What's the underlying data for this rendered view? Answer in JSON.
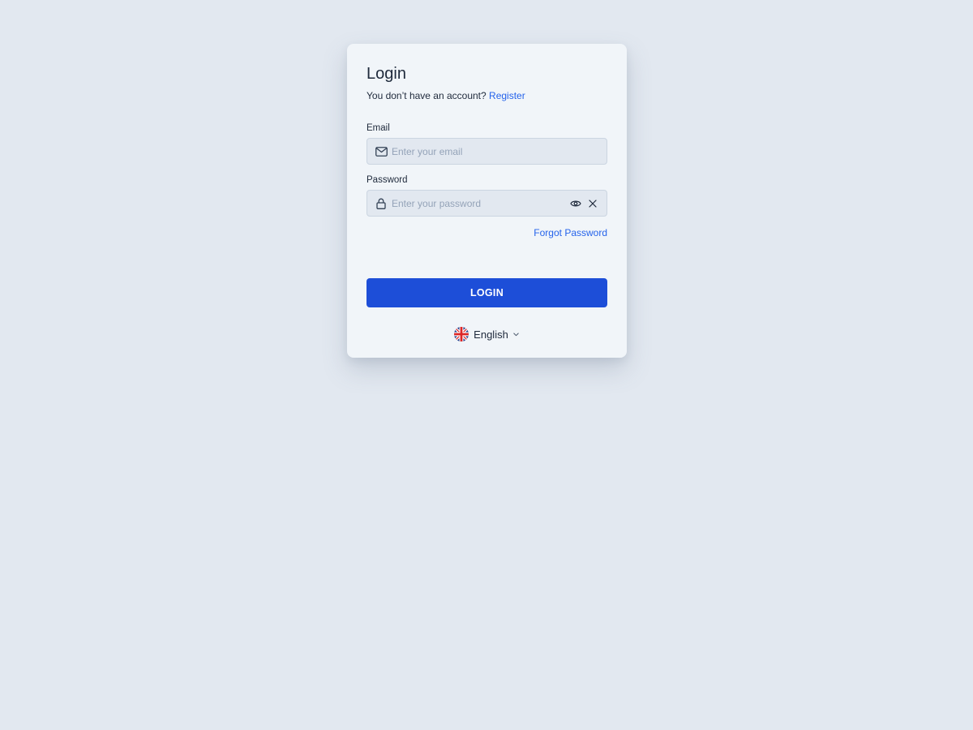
{
  "login": {
    "title": "Login",
    "subtitle_text": "You don’t have an account?",
    "register_link": "Register",
    "email": {
      "label": "Email",
      "placeholder": "Enter your email",
      "value": "",
      "icon": "mail-icon"
    },
    "password": {
      "label": "Password",
      "placeholder": "Enter your password",
      "value": "",
      "icon": "lock-icon",
      "show_icon": "eye-icon",
      "clear_icon": "close-icon"
    },
    "forgot_link": "Forgot Password",
    "submit_label": "LOGIN",
    "language": {
      "selected": "English",
      "flag_icon": "uk-flag-icon",
      "dropdown_icon": "chevron-down-icon"
    }
  },
  "colors": {
    "background": "#e2e8f0",
    "card": "#f1f5f9",
    "accent": "#1d4ed8",
    "link": "#2563eb",
    "text": "#1e293b",
    "placeholder": "#94a3b8"
  }
}
